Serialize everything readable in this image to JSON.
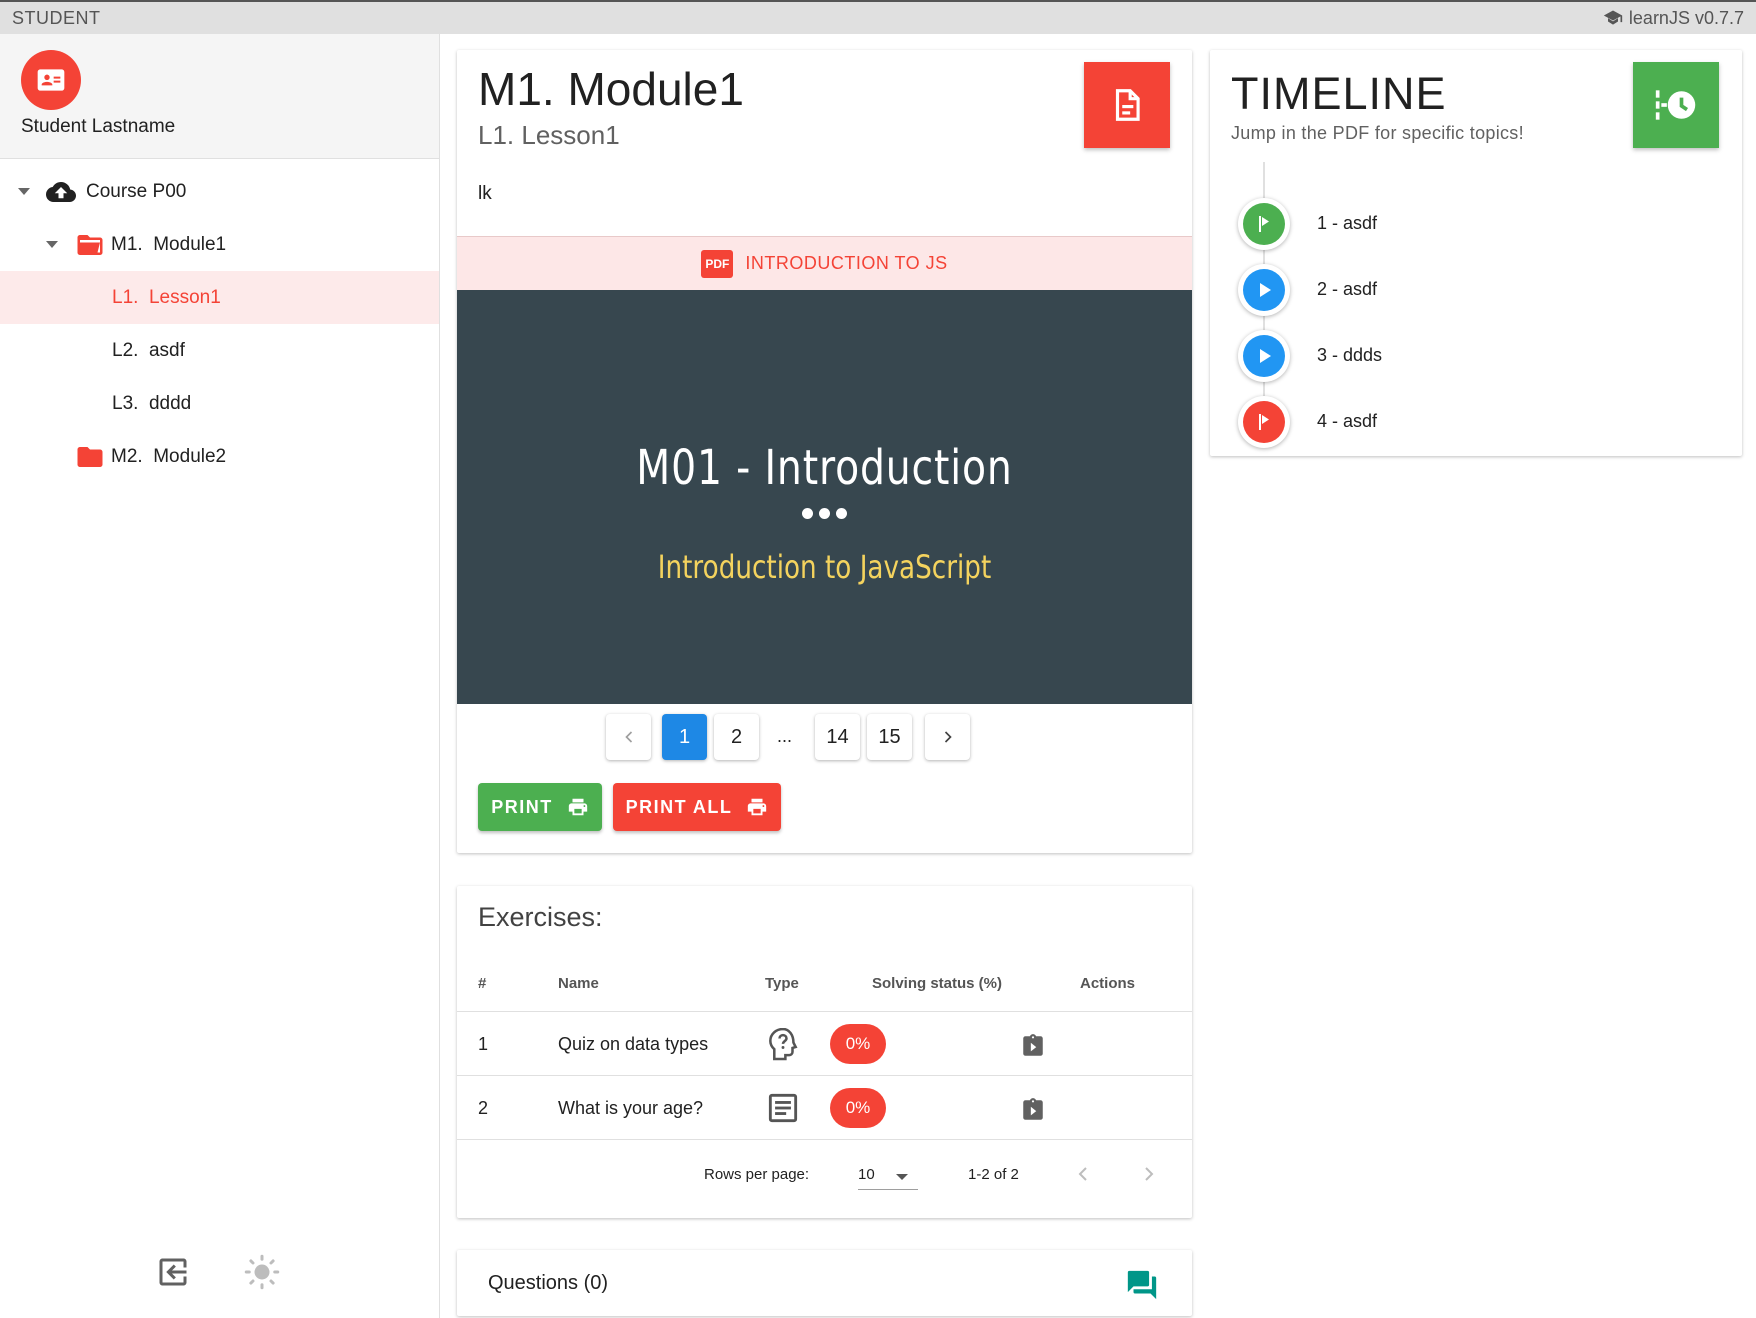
{
  "topbar": {
    "role": "STUDENT",
    "version": "learnJS v0.7.7"
  },
  "sidebar": {
    "user_name": "Student Lastname",
    "tree": [
      {
        "label": "Course P00",
        "level": 0,
        "icon": "cloud-icon",
        "expanded": true
      },
      {
        "label": "M1.  Module1",
        "level": 1,
        "icon": "folder-open-icon",
        "expanded": true
      },
      {
        "label": "L1.  Lesson1",
        "level": 2,
        "active": true
      },
      {
        "label": "L2.  asdf",
        "level": 2
      },
      {
        "label": "L3.  dddd",
        "level": 2
      },
      {
        "label": "M2.  Module2",
        "level": 1,
        "icon": "folder-icon"
      }
    ]
  },
  "lesson": {
    "title": "M1. Module1",
    "subtitle": "L1. Lesson1",
    "description": "lk",
    "pdf_title": "INTRODUCTION TO JS",
    "pdf_icon_text": "PDF",
    "slide": {
      "title": "M01 - Introduction",
      "subtitle": "Introduction to JavaScript"
    },
    "pagination": {
      "pages": [
        "1",
        "2",
        "...",
        "14",
        "15"
      ],
      "current": "1"
    },
    "print_label": "PRINT",
    "print_all_label": "PRINT ALL"
  },
  "exercises": {
    "title": "Exercises:",
    "columns": [
      "#",
      "Name",
      "Type",
      "Solving status (%)",
      "Actions"
    ],
    "rows": [
      {
        "num": "1",
        "name": "Quiz on data types",
        "type": "quiz-icon",
        "status": "0%"
      },
      {
        "num": "2",
        "name": "What is your age?",
        "type": "text-icon",
        "status": "0%"
      }
    ],
    "rows_per_page_label": "Rows per page:",
    "rows_per_page": "10",
    "range": "1-2 of 2"
  },
  "questions": {
    "label": "Questions (0)"
  },
  "timeline": {
    "title": "TIMELINE",
    "subtitle": "Jump in the PDF for specific topics!",
    "items": [
      {
        "label": "1 - asdf",
        "kind": "flag",
        "color": "#4caf50"
      },
      {
        "label": "2 - asdf",
        "kind": "play",
        "color": "#2196f3"
      },
      {
        "label": "3 - ddds",
        "kind": "play",
        "color": "#2196f3"
      },
      {
        "label": "4 - asdf",
        "kind": "flag",
        "color": "#f44336"
      }
    ]
  },
  "colors": {
    "red": "#f44336",
    "green": "#4caf50",
    "blue": "#1e88e5",
    "slide_bg": "#37474f",
    "teal": "#009688"
  }
}
